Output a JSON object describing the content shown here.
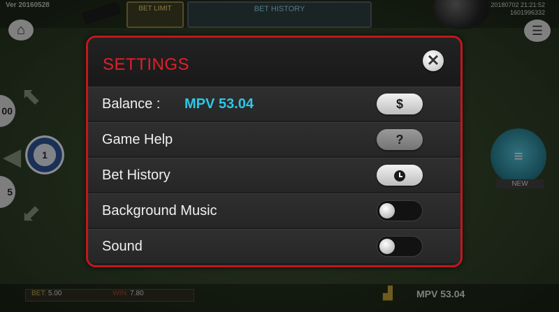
{
  "background": {
    "version": "Ver 20160528",
    "timestamp_line1": "20180702 21:21:52",
    "timestamp_line2": "1601996332",
    "bet_limit_tab": "BET LIMIT",
    "bet_history_tab": "BET HISTORY",
    "chips": [
      "00",
      "1",
      "5"
    ],
    "new_label": "NEW",
    "bet_label": "BET:",
    "bet_value": "5.00",
    "win_label": "WIN:",
    "win_value": "7.80",
    "bottom_balance": "MPV 53.04"
  },
  "icons": {
    "home": "home-icon",
    "menu": "hamburger-menu-icon",
    "close": "close-icon",
    "dollar": "dollar-icon",
    "help": "question-icon",
    "history": "clock-icon"
  },
  "settings": {
    "title": "SETTINGS",
    "close_symbol": "✕",
    "balance_label": "Balance :",
    "balance_value": "MPV 53.04",
    "balance_button": "$",
    "game_help_label": "Game Help",
    "game_help_button": "?",
    "bet_history_label": "Bet History",
    "background_music_label": "Background Music",
    "background_music_on": false,
    "sound_label": "Sound",
    "sound_on": false
  },
  "colors": {
    "accent_red": "#e0202a",
    "border_red": "#c4161c",
    "balance_cyan": "#2ec7e6"
  }
}
